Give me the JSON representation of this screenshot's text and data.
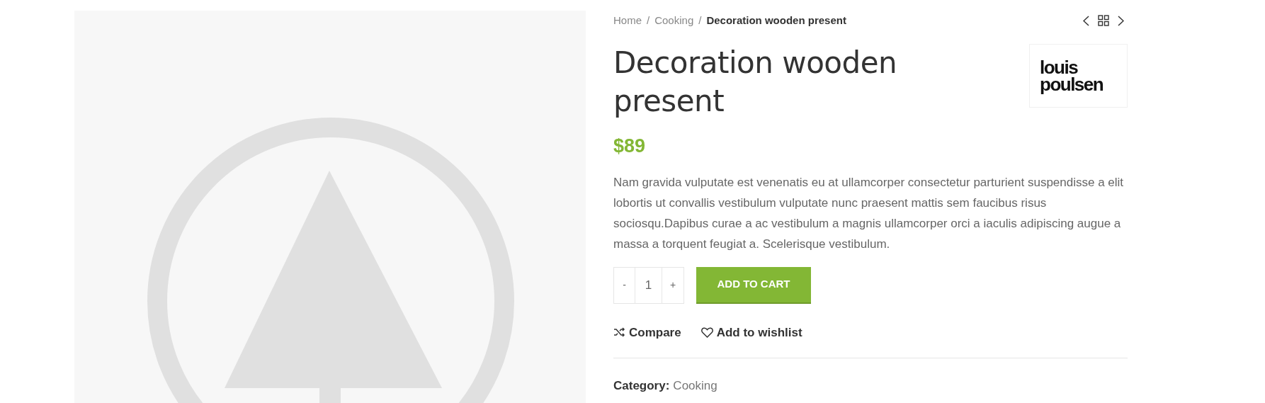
{
  "breadcrumb": [
    {
      "label": "Home",
      "current": false
    },
    {
      "label": "Cooking",
      "current": false
    },
    {
      "label": "Decoration wooden present",
      "current": true
    }
  ],
  "separator": "/",
  "product": {
    "title": "Decoration wooden present",
    "brand_logo": [
      "louis",
      "poulsen"
    ],
    "price": "$89",
    "description": "Nam gravida vulputate est venenatis eu at ullamcorper consectetur parturient suspendisse a elit lobortis ut convallis vestibulum vulputate nunc praesent mattis sem faucibus risus sociosqu.Dapibus curae a ac vestibulum a magnis ullamcorper orci a iaculis adipiscing augue a massa a torquent feugiat a. Scelerisque vestibulum.",
    "quantity": {
      "minus": "-",
      "value": "1",
      "plus": "+"
    },
    "add_to_cart": "ADD TO CART",
    "actions": [
      {
        "kind": "compare",
        "label": "Compare"
      },
      {
        "kind": "wishlist",
        "label": "Add to wishlist"
      }
    ],
    "category": {
      "label": "Category:",
      "value": "Cooking"
    }
  }
}
